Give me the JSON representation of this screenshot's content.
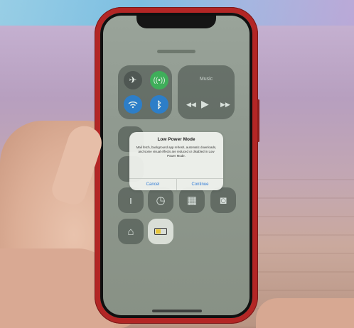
{
  "control_center": {
    "music_label": "Music",
    "icons": {
      "airplane": "airplane-icon",
      "cellular": "cellular-icon",
      "wifi": "wifi-icon",
      "bluetooth": "bluetooth-icon",
      "prev": "◀◀",
      "play": "▶",
      "next": "▶▶"
    }
  },
  "alert": {
    "title": "Low Power Mode",
    "message": "Mail fetch, background app refresh, automatic downloads, and some visual effects are reduced or disabled in Low Power Mode.",
    "cancel_label": "Cancel",
    "continue_label": "Continue"
  },
  "colors": {
    "phone_body": "#b32625",
    "alert_button": "#2f7ad6",
    "cellular_on": "#3fae5a",
    "wifi_on": "#2d7ec8",
    "low_power_battery": "#e8c63a"
  }
}
